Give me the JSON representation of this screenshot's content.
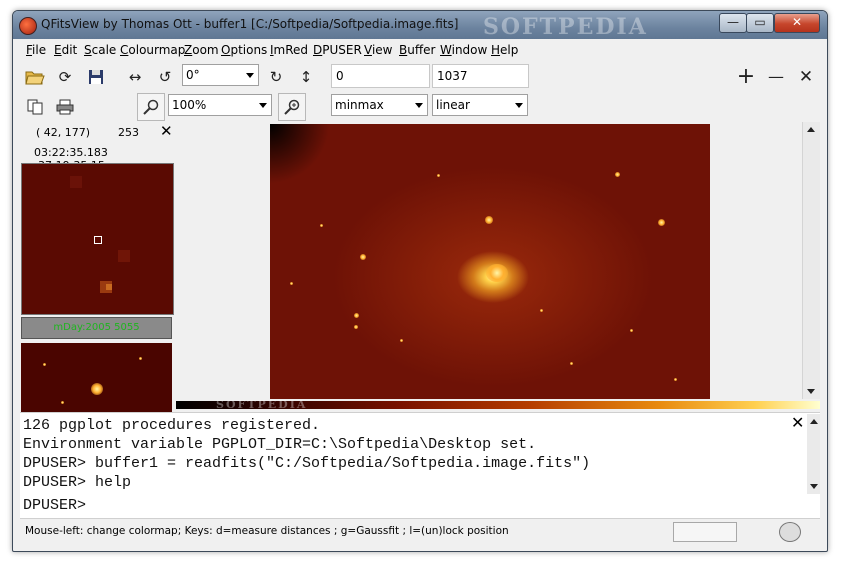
{
  "window": {
    "title": "QFitsView by Thomas Ott - buffer1 [C:/Softpedia/Softpedia.image.fits]",
    "watermark": "SOFTPEDIA",
    "controls": {
      "minimize": "—",
      "maximize": "▭",
      "close": "✕"
    }
  },
  "menu": [
    "File",
    "Edit",
    "Scale",
    "Colourmap",
    "Zoom",
    "Options",
    "ImRed",
    "DPUSER",
    "View",
    "Buffer",
    "Window",
    "Help"
  ],
  "toolbar": {
    "rotation_angle": "0°",
    "range_min": "0",
    "range_max": "1037",
    "zoom_level": "100%",
    "scaling_range": "minmax",
    "scaling_function": "linear",
    "plus": "+",
    "minus": "—",
    "close": "✕"
  },
  "left_panel": {
    "pixel_coords": "( 42, 177)",
    "pixel_value": "253",
    "wcs_coords": "03:22:35.183 -37:19:35.15",
    "cut_label": "mDay:2005   5055"
  },
  "console": {
    "lines": [
      "126 pgplot procedures registered.",
      "Environment variable PGPLOT_DIR=C:\\Softpedia\\Desktop set.",
      "DPUSER> buffer1 = readfits(\"C:/Softpedia/Softpedia.image.fits\")",
      "DPUSER> help",
      "DPUSER>"
    ],
    "close": "✕"
  },
  "statusbar": {
    "text": "Mouse-left: change colormap; Keys: d=measure distances ; g=Gaussfit ; l=(un)lock position"
  },
  "colors": {
    "title_gradient_top": "#8fa4bc",
    "image_background": "#6e1206",
    "close_button": "#c6462c"
  }
}
